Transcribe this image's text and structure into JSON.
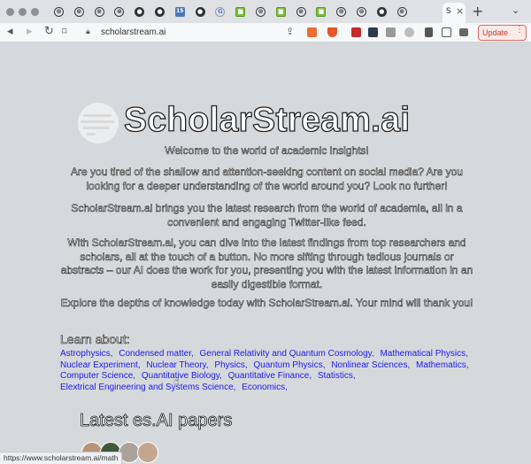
{
  "browser": {
    "tab_icons": [
      "openai-icon",
      "openai-icon",
      "openai-icon",
      "openai-icon",
      "github-icon",
      "github-icon",
      "badge-icon",
      "github-icon",
      "google-icon",
      "app-icon",
      "openai-icon",
      "app-icon",
      "openai-icon",
      "app-icon",
      "openai-icon",
      "openai-icon",
      "github-icon",
      "openai-icon"
    ],
    "tab_glyphs": [
      "⊗",
      "⊗",
      "⊗",
      "⊗",
      "●",
      "●",
      "15",
      "●",
      "G",
      "■",
      "⊗",
      "■",
      "⊗",
      "■",
      "⊗",
      "⊗",
      "●",
      "⊗"
    ],
    "active_tab_glyph": "S",
    "close_glyph": "×",
    "new_tab_glyph": "+",
    "tab_menu_glyph": "⌄",
    "url": "scholarstream.ai",
    "update_label": "Update",
    "menu_glyph": "⋮",
    "status_url": "https://www.scholarstream.ai/math"
  },
  "page": {
    "title": "ScholarStream.ai",
    "welcome": "Welcome to the world of academic insights!",
    "para1": "Are you tired of the shallow and attention-seeking content on social media? Are you looking for a deeper understanding of the world around you? Look no further!",
    "para2": "ScholarStream.ai brings you the latest research from the world of academia, all in a convenient and engaging Twitter-like feed.",
    "para3": "With ScholarStream.ai, you can dive into the latest findings from top researchers and scholars, all at the touch of a button. No more sifting through tedious journals or abstracts – our AI does the work for you, presenting you with the latest information in an easily digestible format.",
    "para4": "Explore the depths of knowledge today with ScholarStream.ai. Your mind will thank you!",
    "learn_about": "Learn about:",
    "topics": [
      "Astrophysics,",
      "Condensed matter,",
      "General Relativity and Quantum Cosmology,",
      "Mathematical Physics,",
      "Nuclear Experiment,",
      "Nuclear Theory,",
      "Physics,",
      "Quantum Physics,",
      "Nonlinear Sciences,",
      "Mathematics,",
      "Computer Science,",
      "Quantitative Biology,",
      "Quantitative Finance,",
      "Statistics,",
      "Elextrical Engineering and Systems Science,",
      "Economics,"
    ],
    "latest_heading": "Latest es.AI papers"
  },
  "colors": {
    "link": "#1a1af0",
    "update_accent": "#c4392b",
    "page_bg": "#d6d9dc"
  }
}
